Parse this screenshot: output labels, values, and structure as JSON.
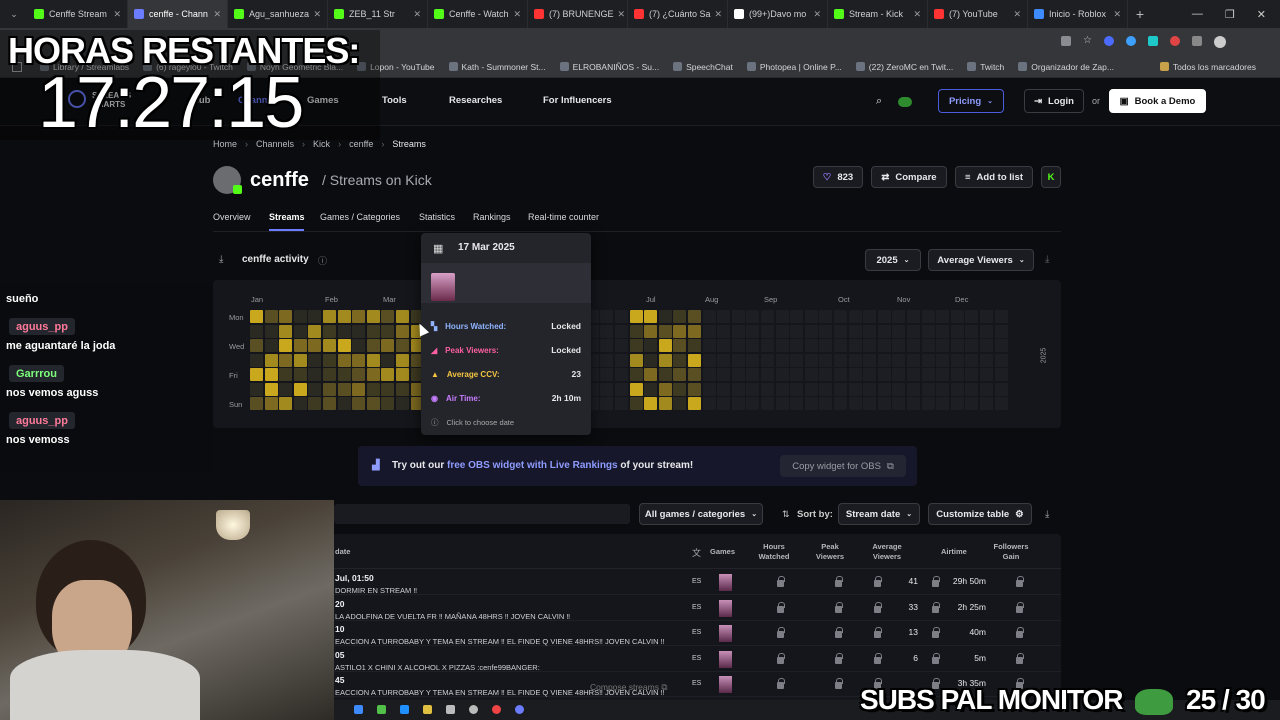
{
  "browser": {
    "tabs": [
      {
        "label": "Cenffe Stream",
        "color": "#53fc18"
      },
      {
        "label": "cenffe - Chann",
        "color": "#6b7cff"
      },
      {
        "label": "Agu_sanhueza",
        "color": "#53fc18"
      },
      {
        "label": "ZEB_11 Str",
        "color": "#53fc18"
      },
      {
        "label": "Cenffe - Watch",
        "color": "#53fc18"
      },
      {
        "label": "(7) BRUNENGE",
        "color": "#ff3333"
      },
      {
        "label": "(7) ¿Cuánto Sa",
        "color": "#ff3333"
      },
      {
        "label": "(99+)Davo mo",
        "color": "#ffffff"
      },
      {
        "label": "Stream - Kick",
        "color": "#53fc18"
      },
      {
        "label": "(7) YouTube",
        "color": "#ff3333"
      },
      {
        "label": "Inicio - Roblox",
        "color": "#3d8bff"
      }
    ],
    "bookmarks": [
      "Library / Streamlabs",
      "(6) rageylo0 - Twitch",
      "Noyh Geometric Bla...",
      "Lopon - YouTube",
      "Kath - Summoner St...",
      "ELROBANIÑOS - Su...",
      "SpeechChat",
      "Photopea | Online P...",
      "(22) ZeroMC en Twit...",
      "Twitch",
      "Organizador de Zap..."
    ],
    "all_bookmarks": "Todos los marcadores"
  },
  "nav": {
    "logo_line1": "STREAMS",
    "logo_line2": "CHARTS",
    "hub": "Hub",
    "channels": "Channels",
    "games": "Games",
    "tools": "Tools",
    "researches": "Researches",
    "influencers": "For Influencers",
    "pricing": "Pricing",
    "login": "Login",
    "or": "or",
    "demo": "Book a Demo"
  },
  "breadcrumb": [
    "Home",
    "Channels",
    "Kick",
    "cenffe",
    "Streams"
  ],
  "channel": {
    "name": "cenffe",
    "subtitle": "/ Streams on Kick",
    "likes": "823",
    "compare": "Compare",
    "add_to_list": "Add to list"
  },
  "subtabs": [
    "Overview",
    "Streams",
    "Games / Categories",
    "Statistics",
    "Rankings",
    "Real-time counter"
  ],
  "activity": {
    "title": "cenffe activity",
    "year": "2025",
    "metric": "Average Viewers",
    "months": [
      "Jan",
      "Feb",
      "Mar",
      "Jul",
      "Aug",
      "Sep",
      "Oct",
      "Nov",
      "Dec"
    ],
    "days": [
      "Mon",
      "Wed",
      "Fri",
      "Sun"
    ],
    "year_label": "2025"
  },
  "tooltip": {
    "date": "17 Mar 2025",
    "rows": [
      {
        "label": "Hours Watched:",
        "value": "Locked",
        "color": "#8fb4ff"
      },
      {
        "label": "Peak Viewers:",
        "value": "Locked",
        "color": "#ff5fa2"
      },
      {
        "label": "Average CCV:",
        "value": "23",
        "color": "#f5c542"
      },
      {
        "label": "Air Time:",
        "value": "2h 10m",
        "color": "#c77dff"
      }
    ],
    "hint": "Click to choose date"
  },
  "promo": {
    "prefix": "Try out our",
    "link": "free OBS widget with Live Rankings",
    "suffix": "of your stream!",
    "button": "Copy widget for OBS"
  },
  "table": {
    "filter": "All games / categories",
    "sort_label": "Sort by:",
    "sort_value": "Stream date",
    "customize": "Customize table",
    "headers": {
      "date": "date",
      "games": "Games",
      "hours": "Hours\nWatched",
      "peak": "Peak\nViewers",
      "avg": "Average\nViewers",
      "airtime": "Airtime",
      "followers": "Followers\nGain"
    },
    "rows": [
      {
        "date": "Jul, 01:50",
        "title": "DORMIR EN STREAM ‼",
        "lang": "ES",
        "avg": "41",
        "airtime": "29h 50m"
      },
      {
        "date": "20",
        "title": "LA ADOLFINA DE VUELTA FR ‼ MAÑANA 48HRS ‼ JOVEN CALVIN ‼",
        "lang": "ES",
        "avg": "33",
        "airtime": "2h 25m"
      },
      {
        "date": "10",
        "title": "EACCION A TURROBABY Y TEMA EN STREAM ‼ EL FINDE Q VIENE 48HRS‼ JOVEN CALVIN ‼",
        "lang": "ES",
        "avg": "13",
        "airtime": "40m"
      },
      {
        "date": "05",
        "title": "ASTILO1 X CHINI X ALCOHOL X PIZZAS :cenfe99BANGER:",
        "lang": "ES",
        "avg": "6",
        "airtime": "5m"
      },
      {
        "date": "45",
        "title": "EACCION A TURROBABY Y TEMA EN STREAM ‼ EL FINDE Q VIENE 48HRS‼ JOVEN CALVIN ‼",
        "lang": "ES",
        "avg": "",
        "airtime": "3h 35m"
      }
    ],
    "compose": "Compose streams"
  },
  "overlay": {
    "hours_label": "HORAS RESTANTES:",
    "timer": "17:27:15",
    "chat": [
      {
        "type": "msg",
        "text": "sueño"
      },
      {
        "type": "user",
        "text": "aguus_pp",
        "color": "#ff7a9a"
      },
      {
        "type": "msg",
        "text": "me aguantaré la joda"
      },
      {
        "type": "user",
        "text": "Garrrou",
        "color": "#7dff7d"
      },
      {
        "type": "msg",
        "text": "nos vemos aguss"
      },
      {
        "type": "user",
        "text": "aguus_pp",
        "color": "#ff7a9a"
      },
      {
        "type": "msg",
        "text": "nos vemoss"
      }
    ],
    "subs": "SUBS PAL MONITOR",
    "subs_count": "25 / 30"
  }
}
